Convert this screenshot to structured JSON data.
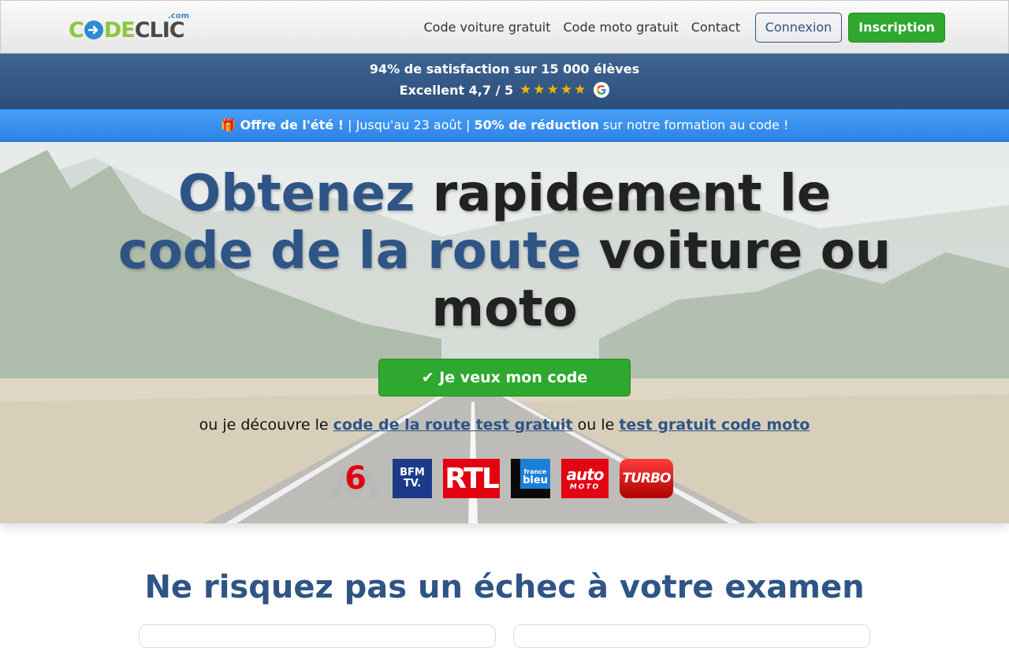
{
  "brand": {
    "logo_co": "C",
    "logo_de": "DE",
    "logo_clic": "CLIC",
    "logo_com": ".com"
  },
  "nav": {
    "links": [
      "Code voiture gratuit",
      "Code moto gratuit",
      "Contact"
    ],
    "login_label": "Connexion",
    "signup_label": "Inscription"
  },
  "rating": {
    "line1": "94% de satisfaction sur 15 000 élèves",
    "line2": "Excellent 4,7 / 5",
    "stars": "★★★★★",
    "rating_value": 4.7
  },
  "promo": {
    "emoji": "🎁",
    "offer": "Offre de l'été !",
    "sep1": " | Jusqu'au 23 août | ",
    "discount": "50% de réduction",
    "tail": " sur notre formation au code !"
  },
  "hero": {
    "title_part1": "Obtenez",
    "title_part2": " rapidement le ",
    "title_part3": "code de la route",
    "title_part4": " voiture ou moto",
    "cta_label": "✔ Je veux mon code",
    "sub_prefix": "ou je découvre le ",
    "sub_link1": "code de la route test gratuit",
    "sub_mid": " ou le ",
    "sub_link2": "test gratuit code moto"
  },
  "media": {
    "m6": "6",
    "bfm_line1": "BFM",
    "bfm_line2": "TV.",
    "rtl": "RTL",
    "fbleu_line1": "france",
    "fbleu_line2": "bleu",
    "auto": "auto",
    "moto": "MOTO",
    "turbo": "TURBO"
  },
  "section": {
    "title": "Ne risquez pas un échec à votre examen"
  },
  "colors": {
    "brand_blue": "#2f5486",
    "green": "#2ea82e",
    "promo_blue": "#2b83e6"
  }
}
